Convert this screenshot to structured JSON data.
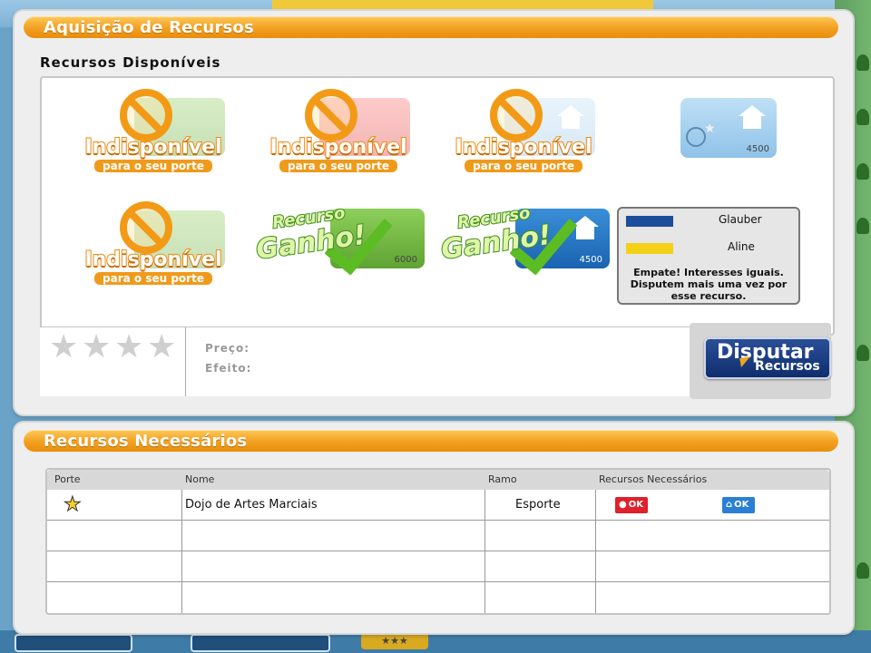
{
  "top_panel": {
    "title": "Aquisição de Recursos",
    "section_label": "Recursos Disponíveis",
    "tiles": [
      {
        "state": "unavailable",
        "line1": "Indisponível",
        "line2": "para o seu porte",
        "card_color": "green"
      },
      {
        "state": "unavailable",
        "line1": "Indisponível",
        "line2": "para o seu porte",
        "card_color": "red"
      },
      {
        "state": "unavailable",
        "line1": "Indisponível",
        "line2": "para o seu porte",
        "card_color": "blue"
      },
      {
        "state": "available",
        "card_color": "blue",
        "icon": "house-icon",
        "value": "4500"
      },
      {
        "state": "unavailable",
        "line1": "Indisponível",
        "line2": "para o seu porte",
        "card_color": "green"
      },
      {
        "state": "won",
        "line1": "Recurso",
        "line2": "Ganho!",
        "card_color": "green",
        "value": "6000"
      },
      {
        "state": "won",
        "line1": "Recurso",
        "line2": "Ganho!",
        "card_color": "blue",
        "value": "4500"
      }
    ],
    "dispute": {
      "players": [
        {
          "name": "Glauber",
          "color": "#1a4e9a"
        },
        {
          "name": "Aline",
          "color": "#f5d019"
        }
      ],
      "message": "Empate! Interesses iguais. Disputem mais uma vez por esse recurso."
    },
    "info": {
      "price_label": "Preço:",
      "effect_label": "Efeito:",
      "stars": 4
    },
    "button": {
      "line1": "Disputar",
      "line2": "Recursos"
    }
  },
  "bottom_panel": {
    "title": "Recursos Necessários",
    "columns": [
      "Porte",
      "Nome",
      "Ramo",
      "Recursos Necessários"
    ],
    "rows": [
      {
        "porte": "star",
        "nome": "Dojo de Artes Marciais",
        "ramo": "Esporte",
        "req1": "OK",
        "req2": "OK"
      }
    ]
  },
  "background": {
    "stars_chip": "★★★"
  }
}
